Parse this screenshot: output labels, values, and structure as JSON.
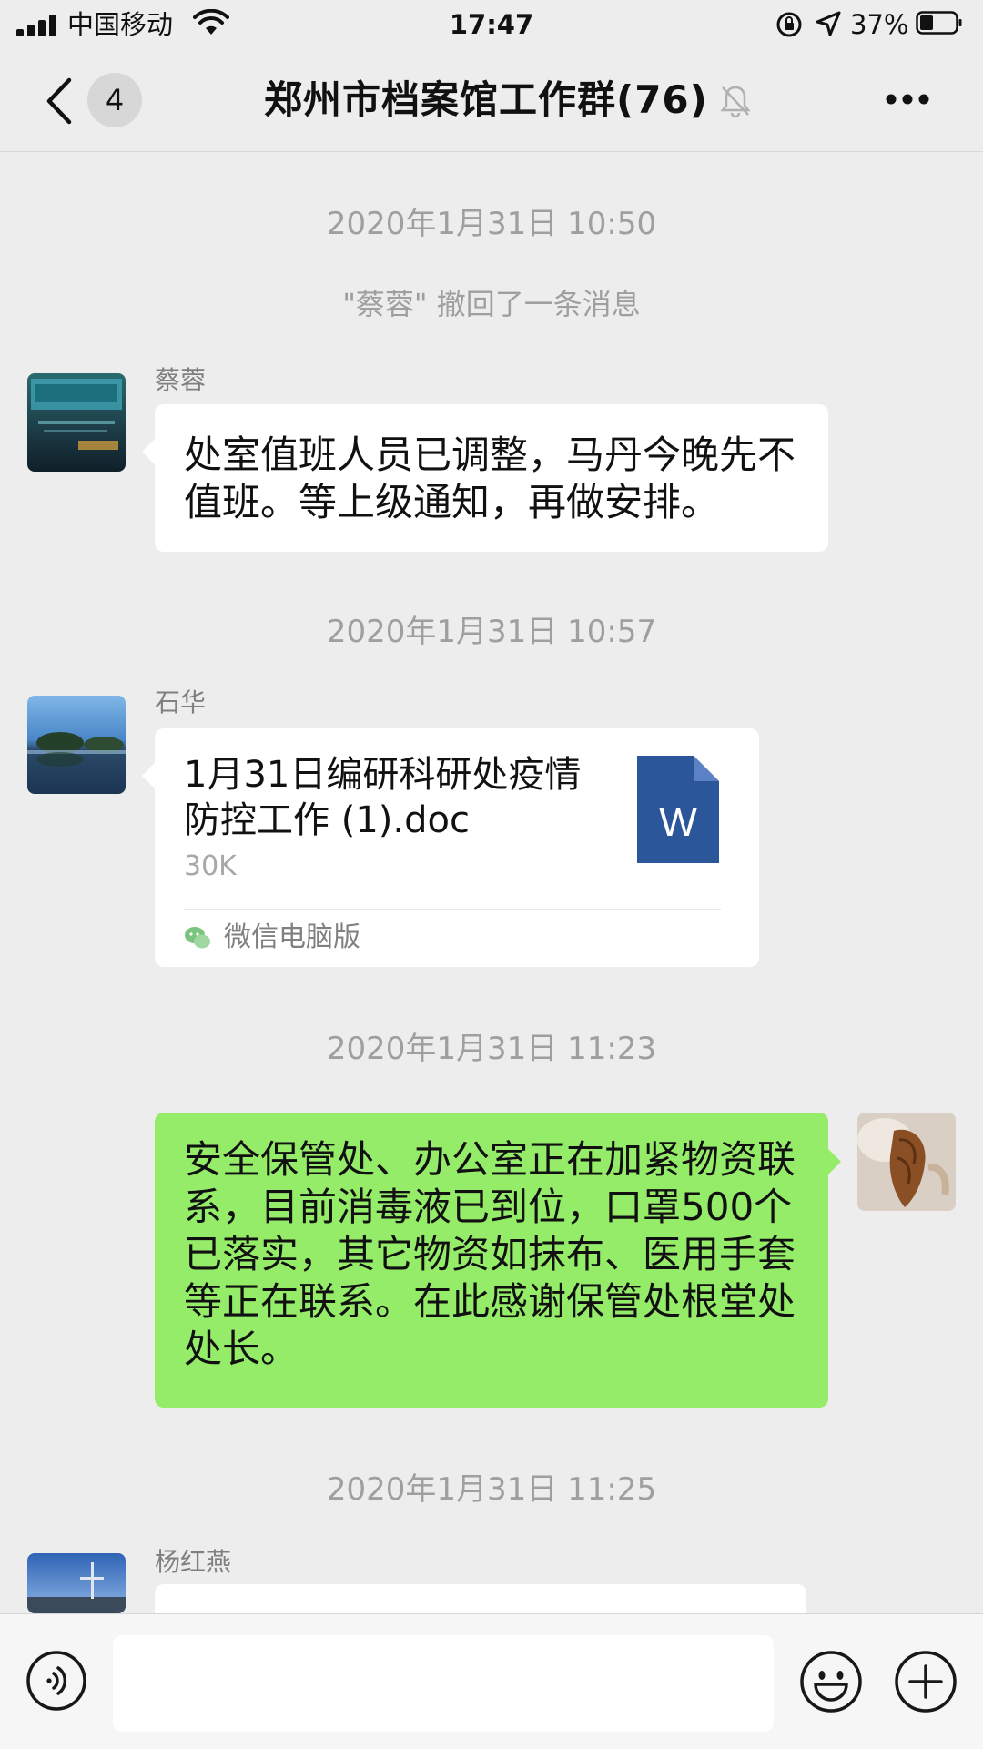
{
  "status_bar": {
    "carrier": "中国移动",
    "time": "17:47",
    "battery_percent": "37%"
  },
  "nav": {
    "unread_count": "4",
    "title": "郑州市档案馆工作群(76)"
  },
  "messages": {
    "ts1": "2020年1月31日 10:50",
    "recall_notice": "\"蔡蓉\" 撤回了一条消息",
    "m1": {
      "sender": "蔡蓉",
      "text": "处室值班人员已调整，马丹今晚先不值班。等上级通知，再做安排。"
    },
    "ts2": "2020年1月31日 10:57",
    "m2": {
      "sender": "石华",
      "file_name": "1月31日编研科研处疫情防控工作 (1).doc",
      "file_size": "30K",
      "file_icon_letter": "W",
      "source": "微信电脑版"
    },
    "ts3": "2020年1月31日 11:23",
    "m3": {
      "text": "安全保管处、办公室正在加紧物资联系，目前消毒液已到位，口罩500个已落实，其它物资如抹布、医用手套等正在联系。在此感谢保管处根堂处处长。"
    },
    "ts4": "2020年1月31日 11:25",
    "m4": {
      "sender": "杨红燕"
    }
  },
  "input": {
    "value": ""
  },
  "colors": {
    "background": "#ededed",
    "bubble_self": "#95ec69",
    "bubble_other": "#ffffff",
    "word_icon": "#2b579a"
  },
  "icons": [
    "back-arrow-icon",
    "mute-bell-icon",
    "more-icon",
    "voice-icon",
    "emoji-icon",
    "plus-icon",
    "word-file-icon",
    "wechat-icon"
  ]
}
